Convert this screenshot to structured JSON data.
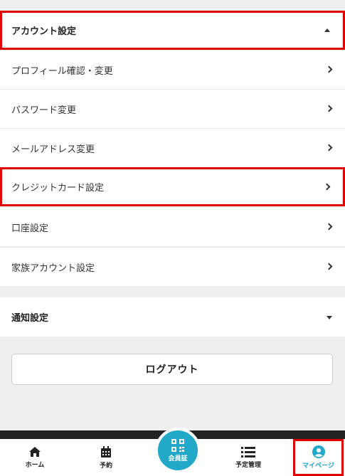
{
  "account_section": {
    "title": "アカウント設定"
  },
  "account_items": [
    {
      "label": "プロフィール確認・変更"
    },
    {
      "label": "パスワード変更"
    },
    {
      "label": "メールアドレス変更"
    },
    {
      "label": "クレジットカード設定"
    },
    {
      "label": "口座設定"
    },
    {
      "label": "家族アカウント設定"
    }
  ],
  "notification_section": {
    "title": "通知設定"
  },
  "logout": {
    "label": "ログアウト"
  },
  "bottom_nav": {
    "home": {
      "label": "ホーム",
      "icon": "home-icon"
    },
    "reserve": {
      "label": "予約",
      "icon": "calendar-icon"
    },
    "member_card": {
      "label": "会員証",
      "icon": "qr-code-icon"
    },
    "schedule": {
      "label": "予定管理",
      "icon": "list-icon"
    },
    "mypage": {
      "label": "マイページ",
      "icon": "user-icon"
    }
  },
  "colors": {
    "accent": "#22a8c9",
    "highlight": "#e00000",
    "background": "#efefef"
  }
}
